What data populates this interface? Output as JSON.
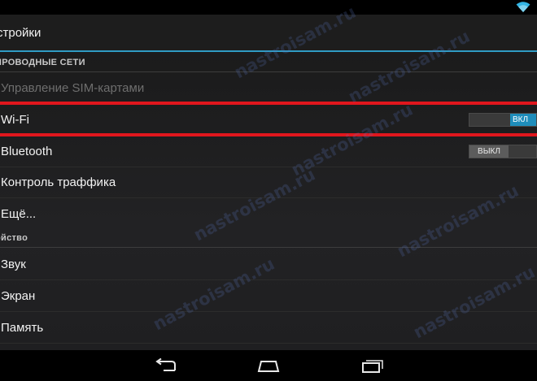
{
  "watermark": "nastroisam.ru",
  "header": {
    "title": "стройки"
  },
  "sections": [
    {
      "label": "ПРОВОДНЫЕ СЕТИ"
    },
    {
      "label": "ойство"
    }
  ],
  "rows": {
    "sim": {
      "label": "Управление SIM-картами"
    },
    "wifi": {
      "label": "Wi-Fi",
      "toggle": "ВКЛ"
    },
    "bluetooth": {
      "label": "Bluetooth",
      "toggle": "ВЫКЛ"
    },
    "traffic": {
      "label": "Контроль траффика"
    },
    "more": {
      "label": "Ещё..."
    },
    "sound": {
      "label": "Звук"
    },
    "screen": {
      "label": "Экран"
    },
    "memory": {
      "label": "Память"
    }
  },
  "colors": {
    "accent": "#2f9bc4",
    "toggle_on": "#1e8dbb",
    "highlight": "#e0161d"
  },
  "icons": {
    "status": "wifi-icon",
    "nav": [
      "back-icon",
      "home-icon",
      "recent-apps-icon"
    ]
  }
}
